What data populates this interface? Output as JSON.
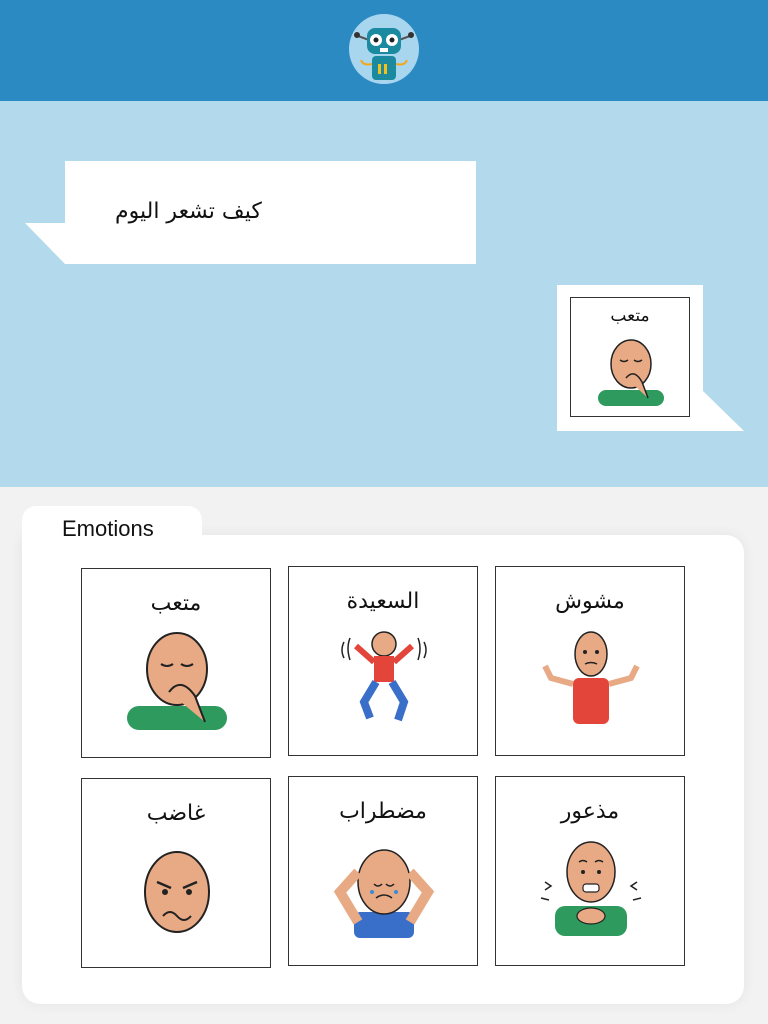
{
  "header": {
    "avatar_icon": "robot-icon",
    "brand_color": "#2a8ac1"
  },
  "chat": {
    "background": "#b2d9ec",
    "question": "كيف تشعر اليوم",
    "answer": {
      "label": "متعب",
      "icon": "tired-face-icon"
    }
  },
  "panel": {
    "tab_label": "Emotions",
    "cards": [
      {
        "label": "متعب",
        "icon": "tired-face-icon"
      },
      {
        "label": "السعيدة",
        "icon": "happy-dance-icon"
      },
      {
        "label": "مشوش",
        "icon": "confused-shrug-icon"
      },
      {
        "label": "غاضب",
        "icon": "angry-face-icon"
      },
      {
        "label": "مضطراب",
        "icon": "upset-crying-icon"
      },
      {
        "label": "مذعور",
        "icon": "scared-trembling-icon"
      }
    ]
  }
}
